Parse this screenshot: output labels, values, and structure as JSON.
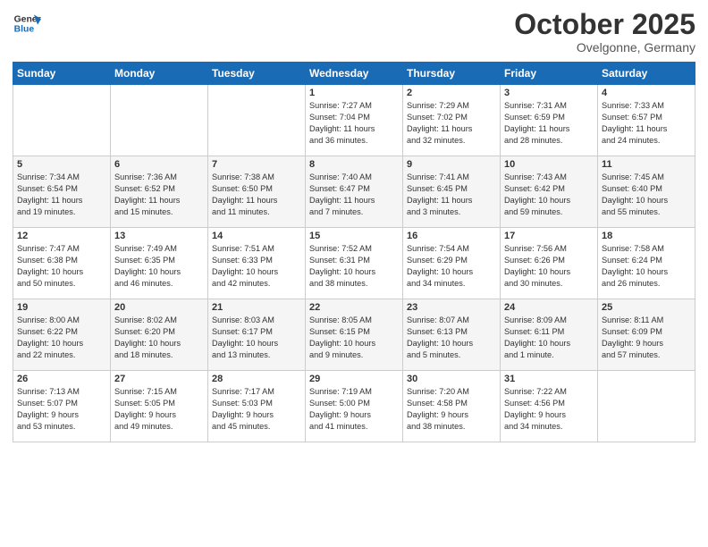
{
  "header": {
    "logo_general": "General",
    "logo_blue": "Blue",
    "month": "October 2025",
    "location": "Ovelgonne, Germany"
  },
  "weekdays": [
    "Sunday",
    "Monday",
    "Tuesday",
    "Wednesday",
    "Thursday",
    "Friday",
    "Saturday"
  ],
  "weeks": [
    [
      {
        "day": "",
        "info": ""
      },
      {
        "day": "",
        "info": ""
      },
      {
        "day": "",
        "info": ""
      },
      {
        "day": "1",
        "info": "Sunrise: 7:27 AM\nSunset: 7:04 PM\nDaylight: 11 hours\nand 36 minutes."
      },
      {
        "day": "2",
        "info": "Sunrise: 7:29 AM\nSunset: 7:02 PM\nDaylight: 11 hours\nand 32 minutes."
      },
      {
        "day": "3",
        "info": "Sunrise: 7:31 AM\nSunset: 6:59 PM\nDaylight: 11 hours\nand 28 minutes."
      },
      {
        "day": "4",
        "info": "Sunrise: 7:33 AM\nSunset: 6:57 PM\nDaylight: 11 hours\nand 24 minutes."
      }
    ],
    [
      {
        "day": "5",
        "info": "Sunrise: 7:34 AM\nSunset: 6:54 PM\nDaylight: 11 hours\nand 19 minutes."
      },
      {
        "day": "6",
        "info": "Sunrise: 7:36 AM\nSunset: 6:52 PM\nDaylight: 11 hours\nand 15 minutes."
      },
      {
        "day": "7",
        "info": "Sunrise: 7:38 AM\nSunset: 6:50 PM\nDaylight: 11 hours\nand 11 minutes."
      },
      {
        "day": "8",
        "info": "Sunrise: 7:40 AM\nSunset: 6:47 PM\nDaylight: 11 hours\nand 7 minutes."
      },
      {
        "day": "9",
        "info": "Sunrise: 7:41 AM\nSunset: 6:45 PM\nDaylight: 11 hours\nand 3 minutes."
      },
      {
        "day": "10",
        "info": "Sunrise: 7:43 AM\nSunset: 6:42 PM\nDaylight: 10 hours\nand 59 minutes."
      },
      {
        "day": "11",
        "info": "Sunrise: 7:45 AM\nSunset: 6:40 PM\nDaylight: 10 hours\nand 55 minutes."
      }
    ],
    [
      {
        "day": "12",
        "info": "Sunrise: 7:47 AM\nSunset: 6:38 PM\nDaylight: 10 hours\nand 50 minutes."
      },
      {
        "day": "13",
        "info": "Sunrise: 7:49 AM\nSunset: 6:35 PM\nDaylight: 10 hours\nand 46 minutes."
      },
      {
        "day": "14",
        "info": "Sunrise: 7:51 AM\nSunset: 6:33 PM\nDaylight: 10 hours\nand 42 minutes."
      },
      {
        "day": "15",
        "info": "Sunrise: 7:52 AM\nSunset: 6:31 PM\nDaylight: 10 hours\nand 38 minutes."
      },
      {
        "day": "16",
        "info": "Sunrise: 7:54 AM\nSunset: 6:29 PM\nDaylight: 10 hours\nand 34 minutes."
      },
      {
        "day": "17",
        "info": "Sunrise: 7:56 AM\nSunset: 6:26 PM\nDaylight: 10 hours\nand 30 minutes."
      },
      {
        "day": "18",
        "info": "Sunrise: 7:58 AM\nSunset: 6:24 PM\nDaylight: 10 hours\nand 26 minutes."
      }
    ],
    [
      {
        "day": "19",
        "info": "Sunrise: 8:00 AM\nSunset: 6:22 PM\nDaylight: 10 hours\nand 22 minutes."
      },
      {
        "day": "20",
        "info": "Sunrise: 8:02 AM\nSunset: 6:20 PM\nDaylight: 10 hours\nand 18 minutes."
      },
      {
        "day": "21",
        "info": "Sunrise: 8:03 AM\nSunset: 6:17 PM\nDaylight: 10 hours\nand 13 minutes."
      },
      {
        "day": "22",
        "info": "Sunrise: 8:05 AM\nSunset: 6:15 PM\nDaylight: 10 hours\nand 9 minutes."
      },
      {
        "day": "23",
        "info": "Sunrise: 8:07 AM\nSunset: 6:13 PM\nDaylight: 10 hours\nand 5 minutes."
      },
      {
        "day": "24",
        "info": "Sunrise: 8:09 AM\nSunset: 6:11 PM\nDaylight: 10 hours\nand 1 minute."
      },
      {
        "day": "25",
        "info": "Sunrise: 8:11 AM\nSunset: 6:09 PM\nDaylight: 9 hours\nand 57 minutes."
      }
    ],
    [
      {
        "day": "26",
        "info": "Sunrise: 7:13 AM\nSunset: 5:07 PM\nDaylight: 9 hours\nand 53 minutes."
      },
      {
        "day": "27",
        "info": "Sunrise: 7:15 AM\nSunset: 5:05 PM\nDaylight: 9 hours\nand 49 minutes."
      },
      {
        "day": "28",
        "info": "Sunrise: 7:17 AM\nSunset: 5:03 PM\nDaylight: 9 hours\nand 45 minutes."
      },
      {
        "day": "29",
        "info": "Sunrise: 7:19 AM\nSunset: 5:00 PM\nDaylight: 9 hours\nand 41 minutes."
      },
      {
        "day": "30",
        "info": "Sunrise: 7:20 AM\nSunset: 4:58 PM\nDaylight: 9 hours\nand 38 minutes."
      },
      {
        "day": "31",
        "info": "Sunrise: 7:22 AM\nSunset: 4:56 PM\nDaylight: 9 hours\nand 34 minutes."
      },
      {
        "day": "",
        "info": ""
      }
    ]
  ]
}
